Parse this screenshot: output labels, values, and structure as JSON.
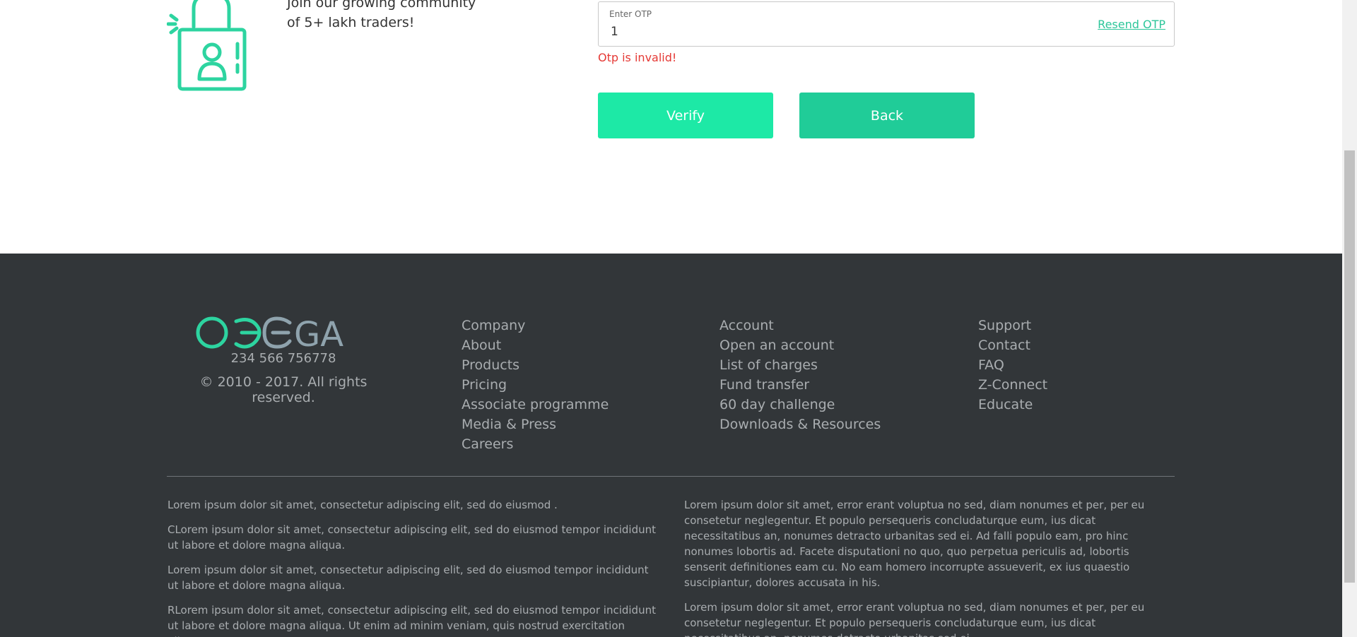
{
  "hero": {
    "tagline_line1": "Join our growing community",
    "tagline_line2": "of 5+ lakh traders!",
    "illustration_icon": "lock-person-icon"
  },
  "otp": {
    "label": "Enter OTP",
    "value": "1",
    "resend_label": "Resend OTP",
    "error": "Otp is invalid!"
  },
  "buttons": {
    "verify": "Verify",
    "back": "Back"
  },
  "footer": {
    "logo_text": "OMEGA",
    "phone": "234 566 756778",
    "copyright": "© 2010 - 2017. All rights reserved.",
    "column1": [
      "Company",
      "About",
      "Products",
      "Pricing",
      "Associate programme",
      "Media & Press",
      "Careers"
    ],
    "column2": [
      "Account",
      "Open an account",
      "List of charges",
      "Fund transfer",
      "60 day challenge",
      "Downloads & Resources"
    ],
    "column3": [
      "Support",
      "Contact",
      "FAQ",
      "Z-Connect",
      "Educate"
    ],
    "legal_left": [
      "Lorem ipsum dolor sit amet, consectetur adipiscing elit, sed do eiusmod .",
      "CLorem ipsum dolor sit amet, consectetur adipiscing elit, sed do eiusmod tempor incididunt ut labore et dolore magna aliqua.",
      "Lorem ipsum dolor sit amet, consectetur adipiscing elit, sed do eiusmod tempor incididunt ut labore et dolore magna aliqua.",
      "RLorem ipsum dolor sit amet, consectetur adipiscing elit, sed do eiusmod tempor incididunt ut labore et dolore magna aliqua. Ut enim ad minim veniam, quis nostrud exercitation ullamco"
    ],
    "legal_right": [
      "Lorem ipsum dolor sit amet, error erant voluptua no sed, diam nonumes et per, per eu consetetur neglegentur. Et populo persequeris concludaturque eum, ius dicat necessitatibus an, nonumes detracto urbanitas sed ei. Ad falli populo eam, pro hinc nonumes lobortis ad. Facete disputationi no quo, quo perpetua periculis ad, lobortis senserit definitiones eam cu. No eam homero incorrupte assueverit, ex ius quaestio suscipiantur, dolores accusata in his.",
      "Lorem ipsum dolor sit amet, error erant voluptua no sed, diam nonumes et per, per eu consetetur neglegentur. Et populo persequeris concludaturque eum, ius dicat necessitatibus an, nonumes detracto urbanitas sed ei."
    ]
  },
  "colors": {
    "accent": "#1de9a6",
    "accent_dark": "#20cc98",
    "error": "#e53935",
    "footer_bg": "#323639",
    "footer_text": "#a9adb0"
  }
}
